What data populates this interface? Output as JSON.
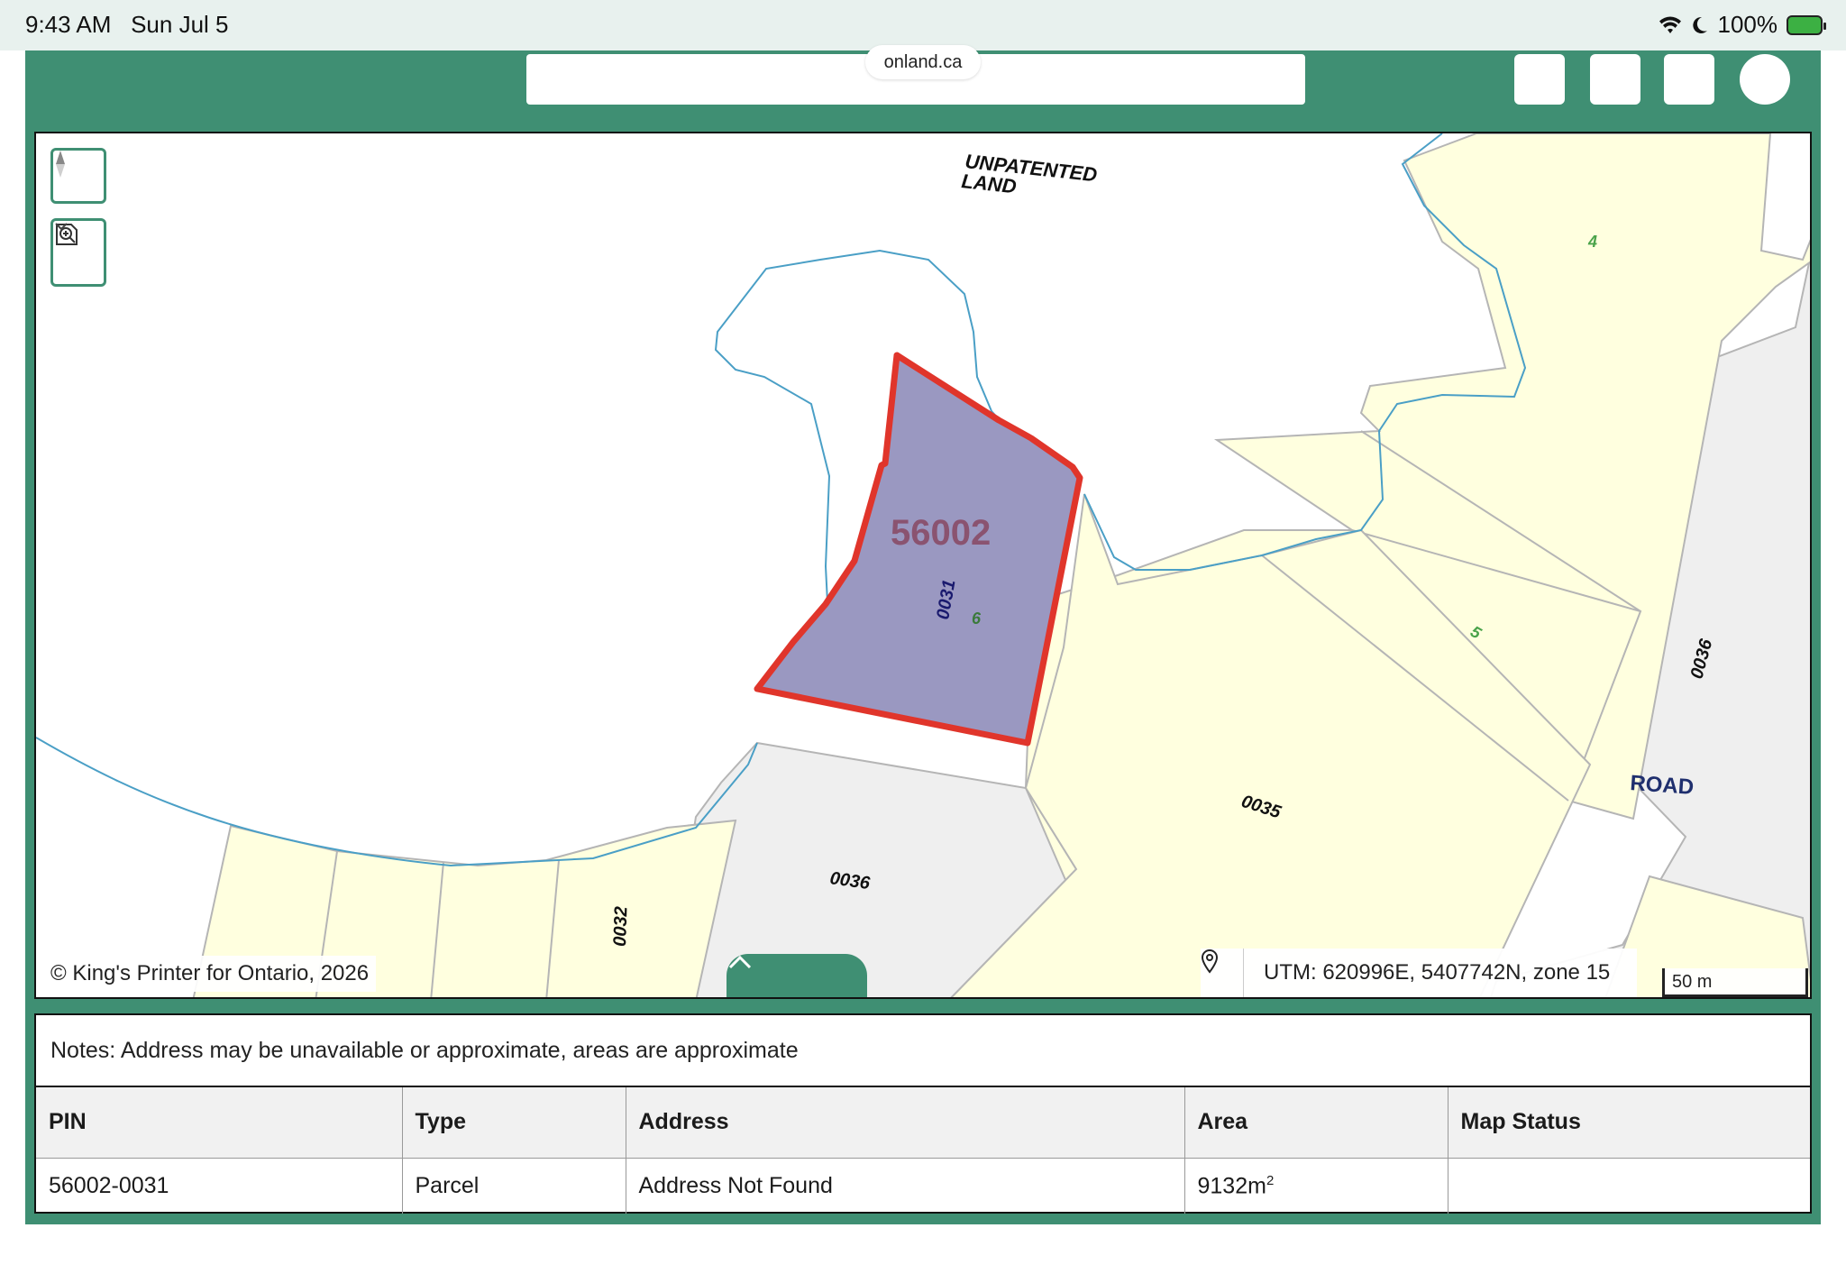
{
  "status_bar": {
    "time": "9:43 AM",
    "date": "Sun Jul 5",
    "battery": "100%",
    "icons": [
      "wifi-icon",
      "moon-icon",
      "battery-charging-icon"
    ]
  },
  "browser": {
    "url": "onland.ca"
  },
  "map": {
    "labels": {
      "unpatented_line1": "UNPATENTED",
      "unpatented_line2": "LAND",
      "block": "56002",
      "selected_parcel": "0031",
      "lot_6": "6",
      "lot_4": "4",
      "lot_5": "5",
      "parcel_0035": "0035",
      "parcel_0036_center": "0036",
      "parcel_0036_right": "0036",
      "parcel_0032": "0032",
      "road": "ROAD"
    },
    "copyright": "© King's Printer for Ontario, 2026",
    "utm": "UTM: 620996E, 5407742N, zone 15",
    "scale": "50 m",
    "controls": [
      "compass-icon",
      "zoom-area-icon",
      "chevron-up-icon",
      "location-pin-icon"
    ],
    "colors": {
      "selected_fill": "#9a98c1",
      "selected_outline": "#e0352b",
      "parcel_yellow": "#ffffdf",
      "road_grey": "#efefef",
      "water_line": "#4a9fc6",
      "frame_green": "#3f8f73"
    }
  },
  "results": {
    "notes": "Notes: Address may be unavailable or approximate, areas are approximate",
    "columns": [
      "PIN",
      "Type",
      "Address",
      "Area",
      "Map Status"
    ],
    "rows": [
      {
        "pin": "56002-0031",
        "type": "Parcel",
        "address": "Address Not Found",
        "area": "9132m",
        "area_sup": "2",
        "map_status": ""
      }
    ]
  }
}
